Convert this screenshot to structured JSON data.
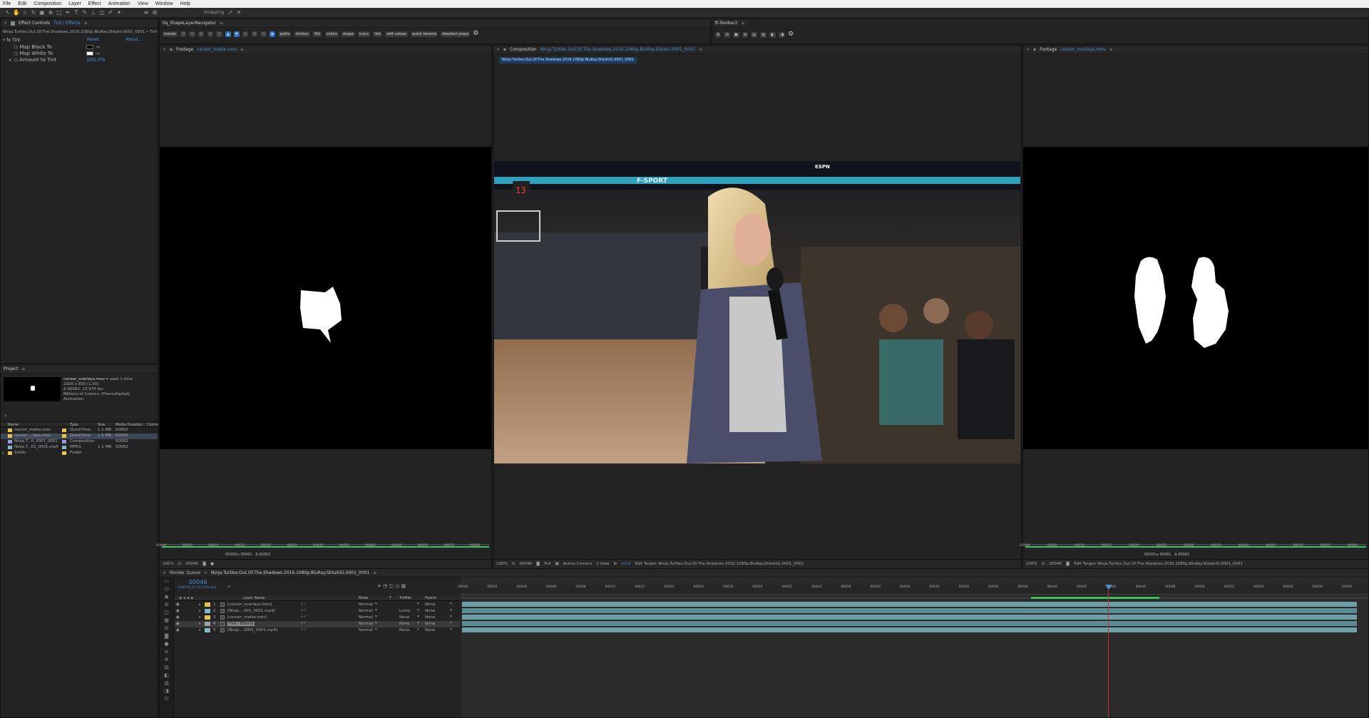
{
  "menu": [
    "File",
    "Edit",
    "Composition",
    "Layer",
    "Effect",
    "Animation",
    "View",
    "Window",
    "Help"
  ],
  "toolbar": {
    "snapping": "Snapping"
  },
  "effect_controls": {
    "tab": "Effect Controls",
    "tab_target": "Tint / Effects",
    "path": "Ninja.Turtles.Out.Of.The.Shadows.2016.1080p.BluRay.Shkahl.0001_0001 • Tint",
    "effect": "Tint",
    "reset": "Reset",
    "about": "About...",
    "map_black": "Map Black To",
    "map_white": "Map White To",
    "amount": "Amount to Tint",
    "amount_val": "100.0%"
  },
  "project": {
    "tab": "Project",
    "selected_name": "censor_overlays.mov",
    "used": "used 1 time",
    "info1": "1920 x 800 (1.00)",
    "info2": "Δ 00062, 23.976 fps",
    "info3": "Millions of Colors+ (Premultiplied)",
    "info4": "Animation",
    "cols": [
      "Name",
      "Type",
      "Size",
      "Media Duration",
      "Comm"
    ],
    "items": [
      {
        "name": "censor_matte.mov",
        "type": "QuickTime",
        "size": "1.2 MB",
        "dur": "00062",
        "color": "#e8c44a"
      },
      {
        "name": "censor_...lays.mov",
        "type": "QuickTime",
        "size": "1.5 MB",
        "dur": "00062",
        "color": "#e8c44a"
      },
      {
        "name": "Ninja.T...0_0001_0001",
        "type": "Composition",
        "size": "",
        "dur": "00062",
        "color": "#9a9ad8"
      },
      {
        "name": "Ninja.T...01_0001.mp4",
        "type": "MPEG",
        "size": "1.1 MB",
        "dur": "00062",
        "color": "#7fb8c8"
      },
      {
        "name": "Solids",
        "type": "Folder",
        "size": "",
        "dur": "",
        "color": "#e8c44a"
      }
    ]
  },
  "plugin_bar": {
    "tab": "liq_ShapeLayerNavigator",
    "labels": [
      "isolate",
      "paths",
      "strokes",
      "fills",
      "colors",
      "shape",
      "trans",
      "link",
      "edit values",
      "quick rename",
      "deselect props"
    ]
  },
  "ft_toolbar": {
    "tab": "ft-Toolbar2"
  },
  "footage_left": {
    "tab": "Footage",
    "name": "censor_matte.mov",
    "zoom": "100%",
    "frame": "00046",
    "tc_in": "00000",
    "tc_out": "00061",
    "tc_dur": "Δ 00062",
    "ticks": [
      "00000",
      "00005",
      "00010",
      "00015",
      "00020",
      "00025",
      "00030",
      "00035",
      "00040",
      "00045",
      "00050",
      "00055",
      "00060"
    ]
  },
  "composition": {
    "tab": "Composition",
    "name": "Ninja.Turtles.Out.Of.The.Shadows.2016.1080p.BluRay.Shkahl.0001_0001",
    "sub_tab": "Ninja.Turtles.Out.Of.The.Shadows.2016.1080p.BluRay.ShkahlG.0001_0001",
    "zoom": "100%",
    "frame": "00046",
    "res": "Full",
    "camera": "Active Camera",
    "view": "1 View",
    "offset": "+0.0",
    "scoreboard": "F-SPORT",
    "shot": "13",
    "broadcast_logo": "ESPN"
  },
  "footage_right": {
    "tab": "Footage",
    "name": "censor_overlays.mov",
    "zoom": "100%",
    "frame": "00046",
    "tc_in": "00000",
    "tc_out": "00061",
    "tc_dur": "Δ 00062",
    "edit_target": "Edit Target: Ninja.Turtles.Out.Of.The.Shadows.2016.1080p.BluRay.ShkahlG.0001_0001",
    "ticks": [
      "00000",
      "00005",
      "00010",
      "00015",
      "00020",
      "00025",
      "00030",
      "00035",
      "00040",
      "00045",
      "00050",
      "00055",
      "00060"
    ]
  },
  "edit_target_mid": "Edit Target: Ninja.Turtles.Out.Of.The.Shadows.2016.1080p.BluRay.ShkahlG.0001_0001",
  "timeline": {
    "tab_render": "Render Queue",
    "tab_comp": "Ninja.Turtles.Out.Of.The.Shadows.2016.1080p.BluRay.ShkahlG.0001_0001",
    "current_time": "00046",
    "fps": "0:00:01:22 (23.976 fps)",
    "cols": [
      "Layer Name",
      "Mode",
      "T",
      "TrkMat",
      "Parent"
    ],
    "ticks": [
      "00000",
      "00002",
      "00004",
      "00006",
      "00008",
      "00010",
      "00012",
      "00014",
      "00016",
      "00018",
      "00020",
      "00022",
      "00024",
      "00026",
      "00028",
      "00030",
      "00032",
      "00034",
      "00036",
      "00038",
      "00040",
      "00042",
      "00044",
      "00046",
      "00048",
      "00050",
      "00052",
      "00054",
      "00056",
      "00058",
      "00060"
    ],
    "layers": [
      {
        "num": "1",
        "name": "[censor_overlays.mov]",
        "mode": "Normal",
        "trk": "",
        "parent": "None",
        "color": "#e8c44a"
      },
      {
        "num": "2",
        "name": "[Ninja....001_0001.mp4]",
        "mode": "Normal",
        "trk": "Luma",
        "parent": "None",
        "color": "#7fb8c8"
      },
      {
        "num": "3",
        "name": "[censor_matte.mov]",
        "mode": "Normal",
        "trk": "None",
        "parent": "None",
        "color": "#e8c44a"
      },
      {
        "num": "4",
        "name": "Tint / Effects",
        "mode": "Normal",
        "trk": "None",
        "parent": "None",
        "color": "#a0a0a0"
      },
      {
        "num": "5",
        "name": "[Ninja....0001_0001.mp4]",
        "mode": "Normal",
        "trk": "None",
        "parent": "None",
        "color": "#7fb8c8"
      }
    ]
  },
  "colors": {
    "accent": "#4a90d9",
    "playhead": "#c03030",
    "workarea": "#3cbf5a",
    "layer_bar": "#5f9aa0"
  }
}
